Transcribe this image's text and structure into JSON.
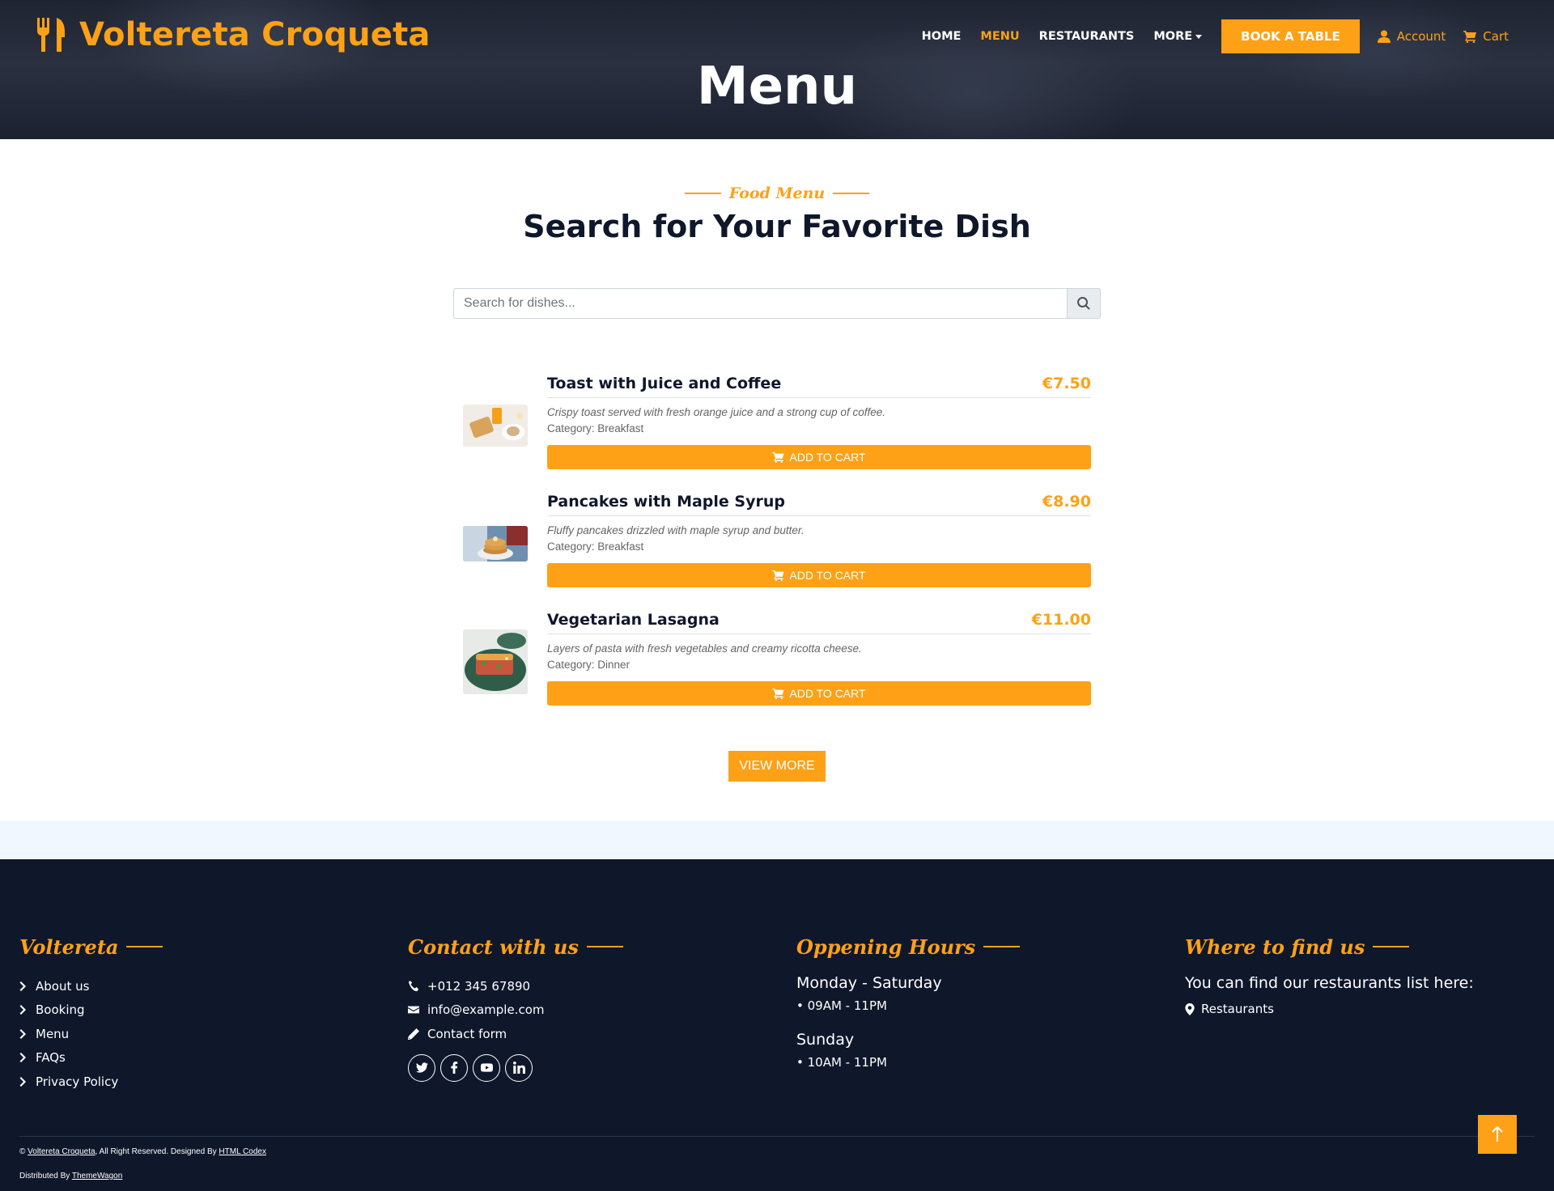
{
  "brand": {
    "name": "Voltereta Croqueta"
  },
  "nav": {
    "home": "HOME",
    "menu": "MENU",
    "restaurants": "RESTAURANTS",
    "more": "MORE",
    "book": "BOOK A TABLE",
    "account": "Account",
    "cart": "Cart"
  },
  "hero": {
    "title": "Menu"
  },
  "section": {
    "subtitle": "Food Menu",
    "heading": "Search for Your Favorite Dish"
  },
  "search": {
    "placeholder": "Search for dishes..."
  },
  "menu_items": [
    {
      "name": "Toast with Juice and Coffee",
      "price": "€7.50",
      "description": "Crispy toast served with fresh orange juice and a strong cup of coffee.",
      "category": "Category: Breakfast",
      "button": "ADD TO CART"
    },
    {
      "name": "Pancakes with Maple Syrup",
      "price": "€8.90",
      "description": "Fluffy pancakes drizzled with maple syrup and butter.",
      "category": "Category: Breakfast",
      "button": "ADD TO CART"
    },
    {
      "name": "Vegetarian Lasagna",
      "price": "€11.00",
      "description": "Layers of pasta with fresh vegetables and creamy ricotta cheese.",
      "category": "Category: Dinner",
      "button": "ADD TO CART"
    }
  ],
  "view_more": "VIEW MORE",
  "footer": {
    "col1": {
      "title": "Voltereta",
      "links": [
        "About us",
        "Booking",
        "Menu",
        "FAQs",
        "Privacy Policy"
      ]
    },
    "col2": {
      "title": "Contact with us",
      "phone": "+012 345 67890",
      "email": "info@example.com",
      "form": "Contact form"
    },
    "col3": {
      "title": "Oppening Hours",
      "day1": "Monday - Saturday",
      "time1": "• 09AM - 11PM",
      "day2": "Sunday",
      "time2": "• 10AM - 11PM"
    },
    "col4": {
      "title": "Where to find us",
      "text": "You can find our restaurants list here:",
      "link": "Restaurants"
    },
    "copyright": {
      "prefix": "© ",
      "brand": "Voltereta Croqueta",
      "middle": ", All Right Reserved. Designed By ",
      "designer": "HTML Codex"
    },
    "distributed": {
      "prefix": "Distributed By ",
      "name": "ThemeWagon"
    }
  },
  "colors": {
    "accent": "#fea116",
    "dark": "#0f172b",
    "band": "#f1f7fe"
  },
  "icons": [
    "utensils-icon",
    "user-icon",
    "cart-icon",
    "search-icon",
    "chevron-right-icon",
    "phone-icon",
    "envelope-icon",
    "pencil-icon",
    "twitter-icon",
    "facebook-icon",
    "youtube-icon",
    "linkedin-icon",
    "map-marker-icon",
    "arrow-up-icon"
  ]
}
